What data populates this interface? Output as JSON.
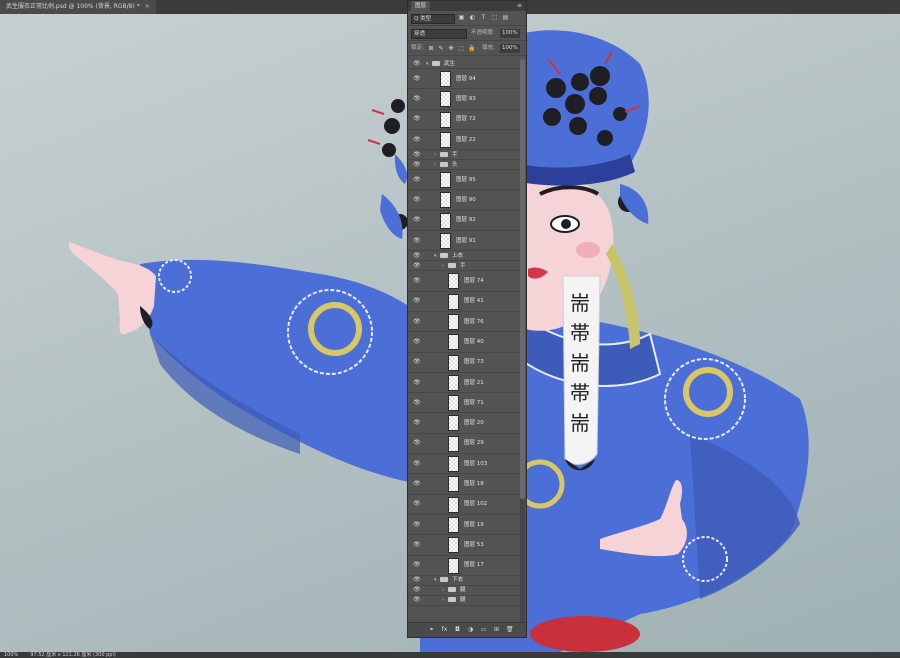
{
  "document_tab": {
    "title": "武生服衣正常比例.psd @ 100% (背景, RGB/8) *",
    "close_glyph": "×"
  },
  "status_bar": {
    "zoom": "100%",
    "size": "97.52 厘米 x 121.26 厘米 (300 ppi)"
  },
  "layers_panel": {
    "title": "图层",
    "menu_glyph": "≡",
    "filter_kind": "Q 类型",
    "filter_icons": [
      "image-filter-icon",
      "adjustment-filter-icon",
      "type-filter-icon",
      "shape-filter-icon",
      "smart-object-filter-icon"
    ],
    "blend_mode": "穿透",
    "opacity_label": "不透明度:",
    "opacity_value": "100%",
    "lock_label": "锁定:",
    "fill_label": "填充:",
    "fill_value": "100%",
    "layers": [
      {
        "name": "武生",
        "kind": "group",
        "indent": 0,
        "open": true
      },
      {
        "name": "图层 94",
        "kind": "layer",
        "indent": 1
      },
      {
        "name": "图层 93",
        "kind": "layer",
        "indent": 1
      },
      {
        "name": "图层 72",
        "kind": "layer",
        "indent": 1
      },
      {
        "name": "图层 22",
        "kind": "layer",
        "indent": 1
      },
      {
        "name": "手",
        "kind": "group",
        "indent": 1,
        "open": false
      },
      {
        "name": "头",
        "kind": "group",
        "indent": 1,
        "open": false
      },
      {
        "name": "图层 95",
        "kind": "layer",
        "indent": 1
      },
      {
        "name": "图层 90",
        "kind": "layer",
        "indent": 1
      },
      {
        "name": "图层 92",
        "kind": "layer",
        "indent": 1
      },
      {
        "name": "图层 91",
        "kind": "layer",
        "indent": 1
      },
      {
        "name": "上衣",
        "kind": "group",
        "indent": 1,
        "open": true
      },
      {
        "name": "手",
        "kind": "group",
        "indent": 2,
        "open": false
      },
      {
        "name": "图层 74",
        "kind": "layer",
        "indent": 2
      },
      {
        "name": "图层 41",
        "kind": "layer",
        "indent": 2
      },
      {
        "name": "图层 76",
        "kind": "layer",
        "indent": 2
      },
      {
        "name": "图层 40",
        "kind": "layer",
        "indent": 2
      },
      {
        "name": "图层 73",
        "kind": "layer",
        "indent": 2
      },
      {
        "name": "图层 21",
        "kind": "layer",
        "indent": 2
      },
      {
        "name": "图层 71",
        "kind": "layer",
        "indent": 2
      },
      {
        "name": "图层 20",
        "kind": "layer",
        "indent": 2
      },
      {
        "name": "图层 29",
        "kind": "layer",
        "indent": 2
      },
      {
        "name": "图层 103",
        "kind": "layer",
        "indent": 2
      },
      {
        "name": "图层 18",
        "kind": "layer",
        "indent": 2
      },
      {
        "name": "图层 102",
        "kind": "layer",
        "indent": 2
      },
      {
        "name": "图层 19",
        "kind": "layer",
        "indent": 2
      },
      {
        "name": "图层 53",
        "kind": "layer",
        "indent": 2
      },
      {
        "name": "图层 17",
        "kind": "layer",
        "indent": 2
      },
      {
        "name": "下衣",
        "kind": "group",
        "indent": 1,
        "open": true
      },
      {
        "name": "腿",
        "kind": "group",
        "indent": 2,
        "open": false
      },
      {
        "name": "腿",
        "kind": "group",
        "indent": 2,
        "open": false
      }
    ],
    "bottom_icons": [
      "link-layers-icon",
      "fx-icon",
      "add-mask-icon",
      "adjustment-layer-icon",
      "new-group-icon",
      "new-layer-icon",
      "delete-layer-icon"
    ],
    "bottom_glyphs": [
      "⚭",
      "fx",
      "◘",
      "◑",
      "▭",
      "⊞",
      "🗑"
    ]
  },
  "artwork": {
    "banner_glyphs": [
      "耑",
      "帯",
      "耑",
      "帯",
      "耑"
    ],
    "colors": {
      "robe_blue": "#4b6fd6",
      "robe_dark": "#3d5bb8",
      "skin": "#f6d3d6",
      "gold": "#d9c766",
      "headdress_ball": "#1e1e24",
      "background": "#b9c4c6"
    }
  }
}
